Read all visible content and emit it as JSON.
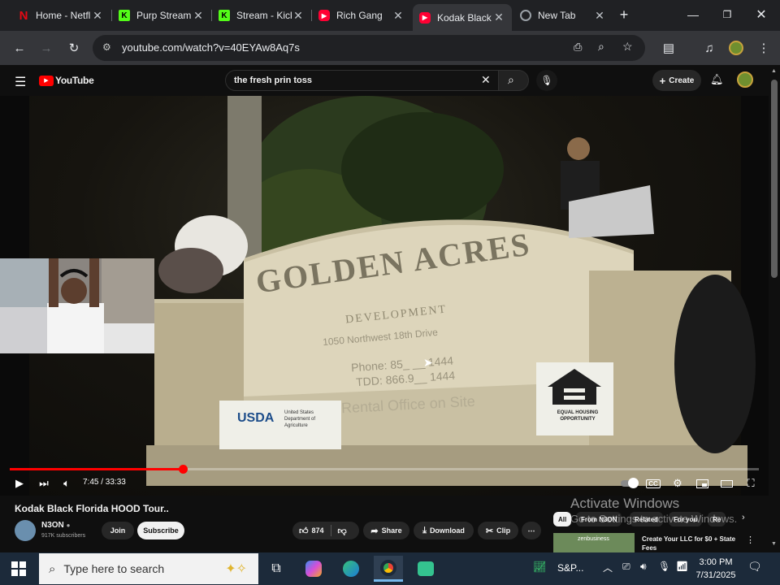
{
  "browser": {
    "tabs": [
      {
        "title": "Home - Netflix",
        "icon": "netflix-icon",
        "color": "#e50914"
      },
      {
        "title": "Purp Stream",
        "icon": "kick-icon",
        "color": "#53fc18"
      },
      {
        "title": "Stream - Kick",
        "icon": "kick-icon",
        "color": "#53fc18"
      },
      {
        "title": "Rich Gang",
        "icon": "youtube-icon",
        "color": "#ff0033"
      },
      {
        "title": "Kodak Black",
        "icon": "youtube-icon",
        "color": "#ff0033",
        "active": true
      },
      {
        "title": "New Tab",
        "icon": "chrome-icon",
        "color": "#9aa0a6"
      }
    ],
    "url": "youtube.com/watch?v=40EYAw8Aq7s"
  },
  "youtube": {
    "logo_text": "YouTube",
    "search_query": "the fresh prin toss",
    "create_label": "Create"
  },
  "player": {
    "current_time": "7:45",
    "duration": "33:33",
    "time_display": "7:45 / 33:33",
    "progress_fraction": 0.2315,
    "sign_text": {
      "title": "GOLDEN ACRES",
      "subtitle": "DEVELOPMENT",
      "address": "1050 Northwest 18th Drive",
      "phone": "Phone: 85_ __ 1444",
      "tdd": "TDD: 866.9__ 1444",
      "rental": "Rental Office on Site",
      "usda_logo": "USDA",
      "usda_line1": "United States",
      "usda_line2": "Department of",
      "usda_line3": "Agriculture",
      "eho_line1": "EQUAL HOUSING",
      "eho_line2": "OPPORTUNITY"
    }
  },
  "video": {
    "title": "Kodak Black Florida HOOD Tour..",
    "channel": "N3ON",
    "subscribers": "917K subscribers",
    "join_label": "Join",
    "subscribe_label": "Subscribe",
    "likes": "874",
    "share_label": "Share",
    "download_label": "Download",
    "clip_label": "Clip"
  },
  "sidebar": {
    "chips": [
      "All",
      "From N3ON",
      "Related",
      "For you",
      "Re"
    ],
    "ad_title": "Create Your LLC for $0 + State Fees",
    "ad_brand": "zenbusiness"
  },
  "watermark": {
    "line1": "Activate Windows",
    "line2": "Go to Settings to activate Windows."
  },
  "taskbar": {
    "search_placeholder": "Type here to search",
    "stock_label": "S&P...",
    "time": "3:00 PM",
    "date": "7/31/2025"
  }
}
